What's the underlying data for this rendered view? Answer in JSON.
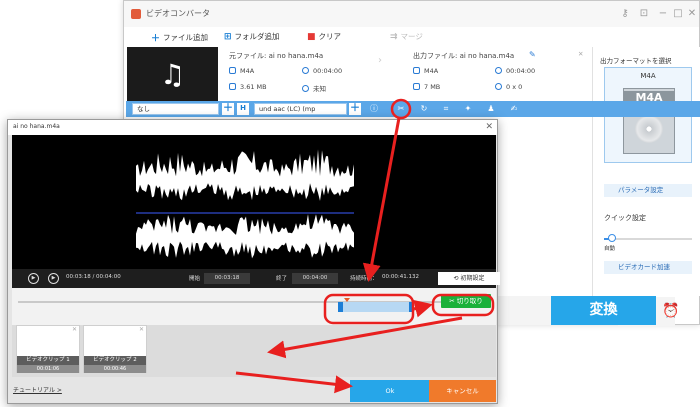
{
  "app": {
    "title": "ビデオコンバータ",
    "window_controls": [
      "−",
      "□",
      "✕"
    ],
    "toolbar": {
      "add_file": "ファイル追加",
      "add_folder": "フォルダ追加",
      "clear": "クリア",
      "merge": "マージ"
    }
  },
  "file": {
    "source_label": "元ファイル: ai no hana.m4a",
    "source_format": "M4A",
    "source_duration": "00:04:00",
    "source_size": "3.61 MB",
    "source_resolution": "未知",
    "output_label": "出力ファイル: ai no hana.m4a",
    "output_format": "M4A",
    "output_duration": "00:04:00",
    "output_size": "7 MB",
    "output_resolution": "0 x 0"
  },
  "tool_strip": {
    "subtitle": "なし",
    "audio_track": "und aac (LC) (mp"
  },
  "right_panel": {
    "select_format_label": "出力フォーマットを選択",
    "format_name": "M4A",
    "format_icon_label": "M4A",
    "param_settings": "パラメータ設定",
    "quick_settings": "クイック設定",
    "auto_label": "自動",
    "gpu_accel": "ビデオカード加速",
    "convert": "変換"
  },
  "dialog": {
    "title": "ai no hana.m4a",
    "current_time": "00:03:18 / 00:04:00",
    "start_label": "開始",
    "start_value": "00:03:18",
    "end_label": "終了",
    "end_value": "00:04:00",
    "duration_label": "持続時間：",
    "duration_value": "00:00:41.132",
    "reset": "初期設定",
    "cut": "切り取り",
    "clips": [
      {
        "name": "ビデオクリップ 1",
        "duration": "00:01:06"
      },
      {
        "name": "ビデオクリップ 2",
        "duration": "00:00:46"
      }
    ],
    "tutorial": "チュートリアル >",
    "ok": "Ok",
    "cancel": "キャンセル"
  },
  "colors": {
    "accent": "#26a6e9",
    "cut_green": "#1ab13a",
    "cancel_orange": "#f07a2b",
    "annotation_red": "#e8201f"
  }
}
